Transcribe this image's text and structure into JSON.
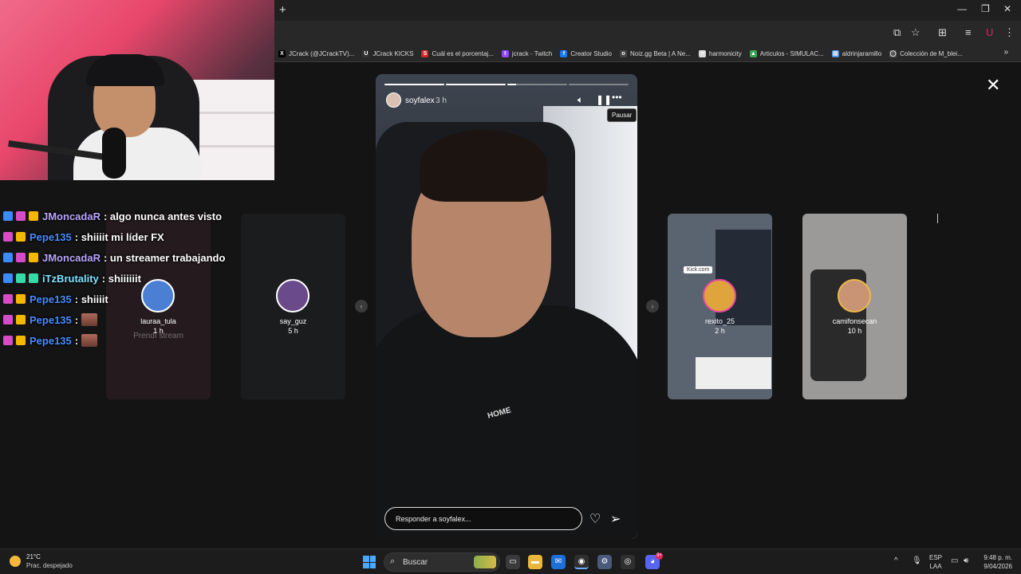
{
  "browser": {
    "new_tab": "+",
    "window_controls": [
      "—",
      "❐",
      "✕"
    ],
    "bookmarks": [
      {
        "label": "JCrack (@JCrackTV)...",
        "icon": "x-icon",
        "color": "#000000",
        "glyph": "X"
      },
      {
        "label": "JCrack KICKS",
        "icon": "jcrack-icon",
        "color": "#333333",
        "glyph": "U"
      },
      {
        "label": "Cuál es el porcentaj...",
        "icon": "s-icon",
        "color": "#d6242b",
        "glyph": "S"
      },
      {
        "label": "jcrack - Twitch",
        "icon": "twitch-icon",
        "color": "#9146ff",
        "glyph": "t"
      },
      {
        "label": "Creator Studio",
        "icon": "facebook-icon",
        "color": "#1877f2",
        "glyph": "f"
      },
      {
        "label": "Noiz.gg Beta | A Ne...",
        "icon": "noiz-icon",
        "color": "#444444",
        "glyph": "o"
      },
      {
        "label": "harmonicity",
        "icon": "doc-icon",
        "color": "#dddddd",
        "glyph": "≡"
      },
      {
        "label": "Articulos - SIMULAC...",
        "icon": "drive-icon",
        "color": "#34a853",
        "glyph": "▲"
      },
      {
        "label": "aldrinjaramillo",
        "icon": "page-icon",
        "color": "#4a90e2",
        "glyph": "▤"
      },
      {
        "label": "Colección de M_blei...",
        "icon": "globe-icon",
        "color": "#555555",
        "glyph": "◯"
      }
    ],
    "more_bookmarks": "»"
  },
  "chat": [
    {
      "user": "JMoncadaR",
      "user_color": "#b9a5ff",
      "badges": [
        "b-blue",
        "b-pink",
        "b-gold"
      ],
      "message": ": algo nunca antes visto",
      "emote": false
    },
    {
      "user": "Pepe135",
      "user_color": "#4a8cff",
      "badges": [
        "b-pink",
        "b-gold"
      ],
      "message": ": shiiiit mi líder FX",
      "emote": false
    },
    {
      "user": "JMoncadaR",
      "user_color": "#b9a5ff",
      "badges": [
        "b-blue",
        "b-pink",
        "b-gold"
      ],
      "message": ": un streamer trabajando",
      "emote": false
    },
    {
      "user": "iTzBrutality",
      "user_color": "#7fe3ff",
      "badges": [
        "b-blue",
        "b-green",
        "b-green"
      ],
      "message": ": shiiiiiit",
      "emote": false
    },
    {
      "user": "Pepe135",
      "user_color": "#4a8cff",
      "badges": [
        "b-pink",
        "b-gold"
      ],
      "message": ": shiiiit",
      "emote": false
    },
    {
      "user": "Pepe135",
      "user_color": "#4a8cff",
      "badges": [
        "b-pink",
        "b-gold"
      ],
      "message": ":",
      "emote": true
    },
    {
      "user": "Pepe135",
      "user_color": "#4a8cff",
      "badges": [
        "b-pink",
        "b-gold"
      ],
      "message": ":",
      "emote": true
    }
  ],
  "stories": {
    "left1": {
      "name": "lauraa_tula",
      "time": "1 h",
      "overlay_text": "Prendí stream",
      "bg": "#3a2a30",
      "avatar": "#4a7fd4"
    },
    "left2": {
      "name": "say_guz",
      "time": "5 h",
      "bg": "#2a2b2e",
      "avatar": "#6a4a8a"
    },
    "right1": {
      "name": "rexito_25",
      "time": "2 h",
      "bg": "#5a6470",
      "avatar": "#e0a43c",
      "tag": "Kick.com"
    },
    "right2": {
      "name": "camifonsecan",
      "time": "10 h",
      "bg": "#9c9a98",
      "avatar": "#c89474"
    },
    "main": {
      "user": "soyfalex",
      "time": "3 h",
      "tooltip": "Pausar",
      "reply_placeholder": "Responder a soyfalex...",
      "shirt_text": "HOME",
      "progress": [
        1,
        1,
        0.15,
        0,
        0
      ]
    }
  },
  "close": "✕",
  "taskbar": {
    "weather_temp": "21°C",
    "weather_desc": "Prac. despejado",
    "search_label": "Buscar",
    "lang_top": "ESP",
    "lang_bottom": "LAA",
    "time": "9:48 p. m.",
    "date": "9/04/2026",
    "discord_badge": "9+"
  }
}
